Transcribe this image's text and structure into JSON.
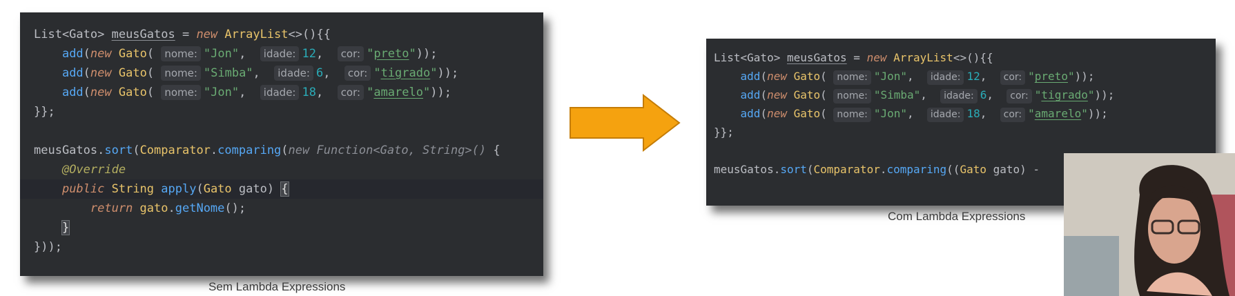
{
  "left_panel": {
    "caption": "Sem Lambda Expressions",
    "lines": [
      [
        [
          "type",
          "List<Gato> "
        ],
        [
          "var",
          "meusGatos"
        ],
        [
          "plain",
          " = "
        ],
        [
          "kw",
          "new "
        ],
        [
          "cls",
          "ArrayList"
        ],
        [
          "plain",
          "<>(){{"
        ]
      ],
      [
        [
          "plain",
          "    "
        ],
        [
          "method",
          "add"
        ],
        [
          "plain",
          "("
        ],
        [
          "kw",
          "new "
        ],
        [
          "cls",
          "Gato"
        ],
        [
          "plain",
          "( "
        ],
        [
          "hint",
          "nome:"
        ],
        [
          "str",
          "\"Jon\""
        ],
        [
          "plain",
          ",  "
        ],
        [
          "hint",
          "idade:"
        ],
        [
          "num",
          "12"
        ],
        [
          "plain",
          ",  "
        ],
        [
          "hint",
          "cor:"
        ],
        [
          "str",
          "\""
        ],
        [
          "str-u",
          "preto"
        ],
        [
          "str",
          "\""
        ],
        [
          "plain",
          "));"
        ]
      ],
      [
        [
          "plain",
          "    "
        ],
        [
          "method",
          "add"
        ],
        [
          "plain",
          "("
        ],
        [
          "kw",
          "new "
        ],
        [
          "cls",
          "Gato"
        ],
        [
          "plain",
          "( "
        ],
        [
          "hint",
          "nome:"
        ],
        [
          "str",
          "\"Simba\""
        ],
        [
          "plain",
          ",  "
        ],
        [
          "hint",
          "idade:"
        ],
        [
          "num",
          "6"
        ],
        [
          "plain",
          ",  "
        ],
        [
          "hint",
          "cor:"
        ],
        [
          "str",
          "\""
        ],
        [
          "str-u",
          "tigrado"
        ],
        [
          "str",
          "\""
        ],
        [
          "plain",
          "));"
        ]
      ],
      [
        [
          "plain",
          "    "
        ],
        [
          "method",
          "add"
        ],
        [
          "plain",
          "("
        ],
        [
          "kw",
          "new "
        ],
        [
          "cls",
          "Gato"
        ],
        [
          "plain",
          "( "
        ],
        [
          "hint",
          "nome:"
        ],
        [
          "str",
          "\"Jon\""
        ],
        [
          "plain",
          ",  "
        ],
        [
          "hint",
          "idade:"
        ],
        [
          "num",
          "18"
        ],
        [
          "plain",
          ",  "
        ],
        [
          "hint",
          "cor:"
        ],
        [
          "str",
          "\""
        ],
        [
          "str-u",
          "amarelo"
        ],
        [
          "str",
          "\""
        ],
        [
          "plain",
          "));"
        ]
      ],
      [
        [
          "plain",
          "}};"
        ]
      ],
      [],
      [
        [
          "plain",
          "meusGatos."
        ],
        [
          "method",
          "sort"
        ],
        [
          "plain",
          "("
        ],
        [
          "cls",
          "Comparator"
        ],
        [
          "plain",
          "."
        ],
        [
          "method",
          "comparing"
        ],
        [
          "plain",
          "("
        ],
        [
          "gray",
          "new "
        ],
        [
          "gray-n",
          "Function<Gato, String>() "
        ],
        [
          "plain",
          "{"
        ]
      ],
      [
        [
          "plain",
          "    "
        ],
        [
          "ann",
          "@Override"
        ]
      ],
      [
        [
          "plain",
          "    "
        ],
        [
          "kw2",
          "public "
        ],
        [
          "cls",
          "String "
        ],
        [
          "method",
          "apply"
        ],
        [
          "plain",
          "("
        ],
        [
          "cls",
          "Gato "
        ],
        [
          "param",
          "gato"
        ],
        [
          "plain",
          ") "
        ],
        [
          "brace",
          "{"
        ]
      ],
      [
        [
          "plain",
          "        "
        ],
        [
          "kw",
          "return "
        ],
        [
          "cls",
          "gato"
        ],
        [
          "plain",
          "."
        ],
        [
          "method",
          "getNome"
        ],
        [
          "plain",
          "();"
        ]
      ],
      [
        [
          "plain",
          "    "
        ],
        [
          "brace",
          "}"
        ]
      ],
      [
        [
          "plain",
          "}));"
        ]
      ]
    ]
  },
  "right_panel": {
    "caption": "Com Lambda Expressions",
    "lines": [
      [
        [
          "type",
          "List<Gato> "
        ],
        [
          "var",
          "meusGatos"
        ],
        [
          "plain",
          " = "
        ],
        [
          "kw",
          "new "
        ],
        [
          "cls",
          "ArrayList"
        ],
        [
          "plain",
          "<>(){{"
        ]
      ],
      [
        [
          "plain",
          "    "
        ],
        [
          "method",
          "add"
        ],
        [
          "plain",
          "("
        ],
        [
          "kw",
          "new "
        ],
        [
          "cls",
          "Gato"
        ],
        [
          "plain",
          "( "
        ],
        [
          "hint",
          "nome:"
        ],
        [
          "str",
          "\"Jon\""
        ],
        [
          "plain",
          ",  "
        ],
        [
          "hint",
          "idade:"
        ],
        [
          "num",
          "12"
        ],
        [
          "plain",
          ",  "
        ],
        [
          "hint",
          "cor:"
        ],
        [
          "str",
          "\""
        ],
        [
          "str-u",
          "preto"
        ],
        [
          "str",
          "\""
        ],
        [
          "plain",
          "));"
        ]
      ],
      [
        [
          "plain",
          "    "
        ],
        [
          "method",
          "add"
        ],
        [
          "plain",
          "("
        ],
        [
          "kw",
          "new "
        ],
        [
          "cls",
          "Gato"
        ],
        [
          "plain",
          "( "
        ],
        [
          "hint",
          "nome:"
        ],
        [
          "str",
          "\"Simba\""
        ],
        [
          "plain",
          ",  "
        ],
        [
          "hint",
          "idade:"
        ],
        [
          "num",
          "6"
        ],
        [
          "plain",
          ",  "
        ],
        [
          "hint",
          "cor:"
        ],
        [
          "str",
          "\""
        ],
        [
          "str-u",
          "tigrado"
        ],
        [
          "str",
          "\""
        ],
        [
          "plain",
          "));"
        ]
      ],
      [
        [
          "plain",
          "    "
        ],
        [
          "method",
          "add"
        ],
        [
          "plain",
          "("
        ],
        [
          "kw",
          "new "
        ],
        [
          "cls",
          "Gato"
        ],
        [
          "plain",
          "( "
        ],
        [
          "hint",
          "nome:"
        ],
        [
          "str",
          "\"Jon\""
        ],
        [
          "plain",
          ",  "
        ],
        [
          "hint",
          "idade:"
        ],
        [
          "num",
          "18"
        ],
        [
          "plain",
          ",  "
        ],
        [
          "hint",
          "cor:"
        ],
        [
          "str",
          "\""
        ],
        [
          "str-u",
          "amarelo"
        ],
        [
          "str",
          "\""
        ],
        [
          "plain",
          "));"
        ]
      ],
      [
        [
          "plain",
          "}};"
        ]
      ],
      [],
      [
        [
          "plain",
          "meusGatos."
        ],
        [
          "method",
          "sort"
        ],
        [
          "plain",
          "("
        ],
        [
          "cls",
          "Comparator"
        ],
        [
          "plain",
          "."
        ],
        [
          "method",
          "comparing"
        ],
        [
          "plain",
          "(("
        ],
        [
          "cls",
          "Gato "
        ],
        [
          "param",
          "gato"
        ],
        [
          "plain",
          ") -"
        ]
      ]
    ]
  },
  "colors": {
    "editor_bg": "#2b2d30",
    "arrow": "#f5a20f",
    "arrow_edge": "#c47c06"
  },
  "arrow_icon": "right-arrow-icon"
}
